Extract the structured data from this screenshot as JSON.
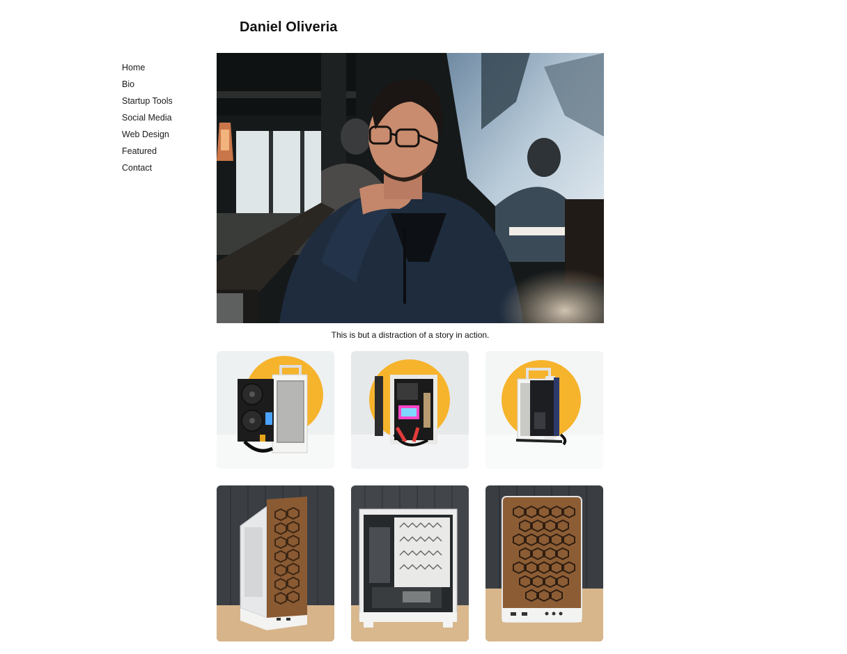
{
  "site": {
    "title": "Daniel Oliveria"
  },
  "nav": {
    "items": [
      {
        "label": "Home"
      },
      {
        "label": "Bio"
      },
      {
        "label": "Startup Tools"
      },
      {
        "label": "Social Media"
      },
      {
        "label": "Web Design"
      },
      {
        "label": "Featured"
      },
      {
        "label": "Contact"
      }
    ]
  },
  "hero": {
    "caption": "This is but a distraction of a story in action."
  },
  "gallery": {
    "colors": {
      "accent_circle": "#f6b32c",
      "studio_bg": "#eef1f1",
      "wood": "#8a5a33",
      "wall": "#3b3f44",
      "table": "#d7b48a"
    }
  }
}
